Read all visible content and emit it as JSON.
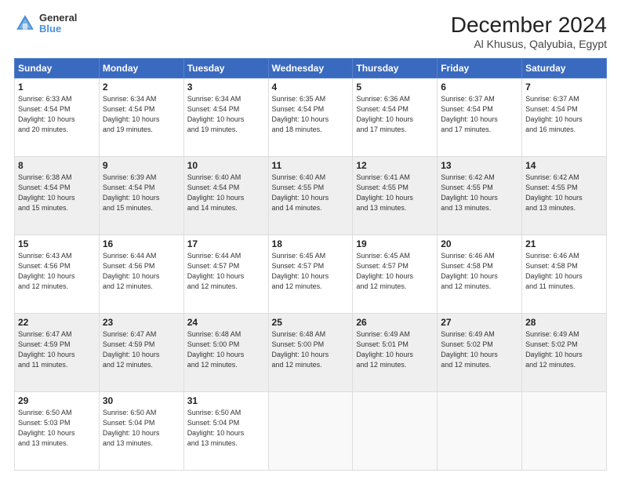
{
  "logo": {
    "line1": "General",
    "line2": "Blue"
  },
  "title": "December 2024",
  "subtitle": "Al Khusus, Qalyubia, Egypt",
  "days_header": [
    "Sunday",
    "Monday",
    "Tuesday",
    "Wednesday",
    "Thursday",
    "Friday",
    "Saturday"
  ],
  "weeks": [
    [
      {
        "day": "1",
        "info": "Sunrise: 6:33 AM\nSunset: 4:54 PM\nDaylight: 10 hours\nand 20 minutes."
      },
      {
        "day": "2",
        "info": "Sunrise: 6:34 AM\nSunset: 4:54 PM\nDaylight: 10 hours\nand 19 minutes."
      },
      {
        "day": "3",
        "info": "Sunrise: 6:34 AM\nSunset: 4:54 PM\nDaylight: 10 hours\nand 19 minutes."
      },
      {
        "day": "4",
        "info": "Sunrise: 6:35 AM\nSunset: 4:54 PM\nDaylight: 10 hours\nand 18 minutes."
      },
      {
        "day": "5",
        "info": "Sunrise: 6:36 AM\nSunset: 4:54 PM\nDaylight: 10 hours\nand 17 minutes."
      },
      {
        "day": "6",
        "info": "Sunrise: 6:37 AM\nSunset: 4:54 PM\nDaylight: 10 hours\nand 17 minutes."
      },
      {
        "day": "7",
        "info": "Sunrise: 6:37 AM\nSunset: 4:54 PM\nDaylight: 10 hours\nand 16 minutes."
      }
    ],
    [
      {
        "day": "8",
        "info": "Sunrise: 6:38 AM\nSunset: 4:54 PM\nDaylight: 10 hours\nand 15 minutes."
      },
      {
        "day": "9",
        "info": "Sunrise: 6:39 AM\nSunset: 4:54 PM\nDaylight: 10 hours\nand 15 minutes."
      },
      {
        "day": "10",
        "info": "Sunrise: 6:40 AM\nSunset: 4:54 PM\nDaylight: 10 hours\nand 14 minutes."
      },
      {
        "day": "11",
        "info": "Sunrise: 6:40 AM\nSunset: 4:55 PM\nDaylight: 10 hours\nand 14 minutes."
      },
      {
        "day": "12",
        "info": "Sunrise: 6:41 AM\nSunset: 4:55 PM\nDaylight: 10 hours\nand 13 minutes."
      },
      {
        "day": "13",
        "info": "Sunrise: 6:42 AM\nSunset: 4:55 PM\nDaylight: 10 hours\nand 13 minutes."
      },
      {
        "day": "14",
        "info": "Sunrise: 6:42 AM\nSunset: 4:55 PM\nDaylight: 10 hours\nand 13 minutes."
      }
    ],
    [
      {
        "day": "15",
        "info": "Sunrise: 6:43 AM\nSunset: 4:56 PM\nDaylight: 10 hours\nand 12 minutes."
      },
      {
        "day": "16",
        "info": "Sunrise: 6:44 AM\nSunset: 4:56 PM\nDaylight: 10 hours\nand 12 minutes."
      },
      {
        "day": "17",
        "info": "Sunrise: 6:44 AM\nSunset: 4:57 PM\nDaylight: 10 hours\nand 12 minutes."
      },
      {
        "day": "18",
        "info": "Sunrise: 6:45 AM\nSunset: 4:57 PM\nDaylight: 10 hours\nand 12 minutes."
      },
      {
        "day": "19",
        "info": "Sunrise: 6:45 AM\nSunset: 4:57 PM\nDaylight: 10 hours\nand 12 minutes."
      },
      {
        "day": "20",
        "info": "Sunrise: 6:46 AM\nSunset: 4:58 PM\nDaylight: 10 hours\nand 12 minutes."
      },
      {
        "day": "21",
        "info": "Sunrise: 6:46 AM\nSunset: 4:58 PM\nDaylight: 10 hours\nand 11 minutes."
      }
    ],
    [
      {
        "day": "22",
        "info": "Sunrise: 6:47 AM\nSunset: 4:59 PM\nDaylight: 10 hours\nand 11 minutes."
      },
      {
        "day": "23",
        "info": "Sunrise: 6:47 AM\nSunset: 4:59 PM\nDaylight: 10 hours\nand 12 minutes."
      },
      {
        "day": "24",
        "info": "Sunrise: 6:48 AM\nSunset: 5:00 PM\nDaylight: 10 hours\nand 12 minutes."
      },
      {
        "day": "25",
        "info": "Sunrise: 6:48 AM\nSunset: 5:00 PM\nDaylight: 10 hours\nand 12 minutes."
      },
      {
        "day": "26",
        "info": "Sunrise: 6:49 AM\nSunset: 5:01 PM\nDaylight: 10 hours\nand 12 minutes."
      },
      {
        "day": "27",
        "info": "Sunrise: 6:49 AM\nSunset: 5:02 PM\nDaylight: 10 hours\nand 12 minutes."
      },
      {
        "day": "28",
        "info": "Sunrise: 6:49 AM\nSunset: 5:02 PM\nDaylight: 10 hours\nand 12 minutes."
      }
    ],
    [
      {
        "day": "29",
        "info": "Sunrise: 6:50 AM\nSunset: 5:03 PM\nDaylight: 10 hours\nand 13 minutes."
      },
      {
        "day": "30",
        "info": "Sunrise: 6:50 AM\nSunset: 5:04 PM\nDaylight: 10 hours\nand 13 minutes."
      },
      {
        "day": "31",
        "info": "Sunrise: 6:50 AM\nSunset: 5:04 PM\nDaylight: 10 hours\nand 13 minutes."
      },
      {
        "day": "",
        "info": ""
      },
      {
        "day": "",
        "info": ""
      },
      {
        "day": "",
        "info": ""
      },
      {
        "day": "",
        "info": ""
      }
    ]
  ]
}
